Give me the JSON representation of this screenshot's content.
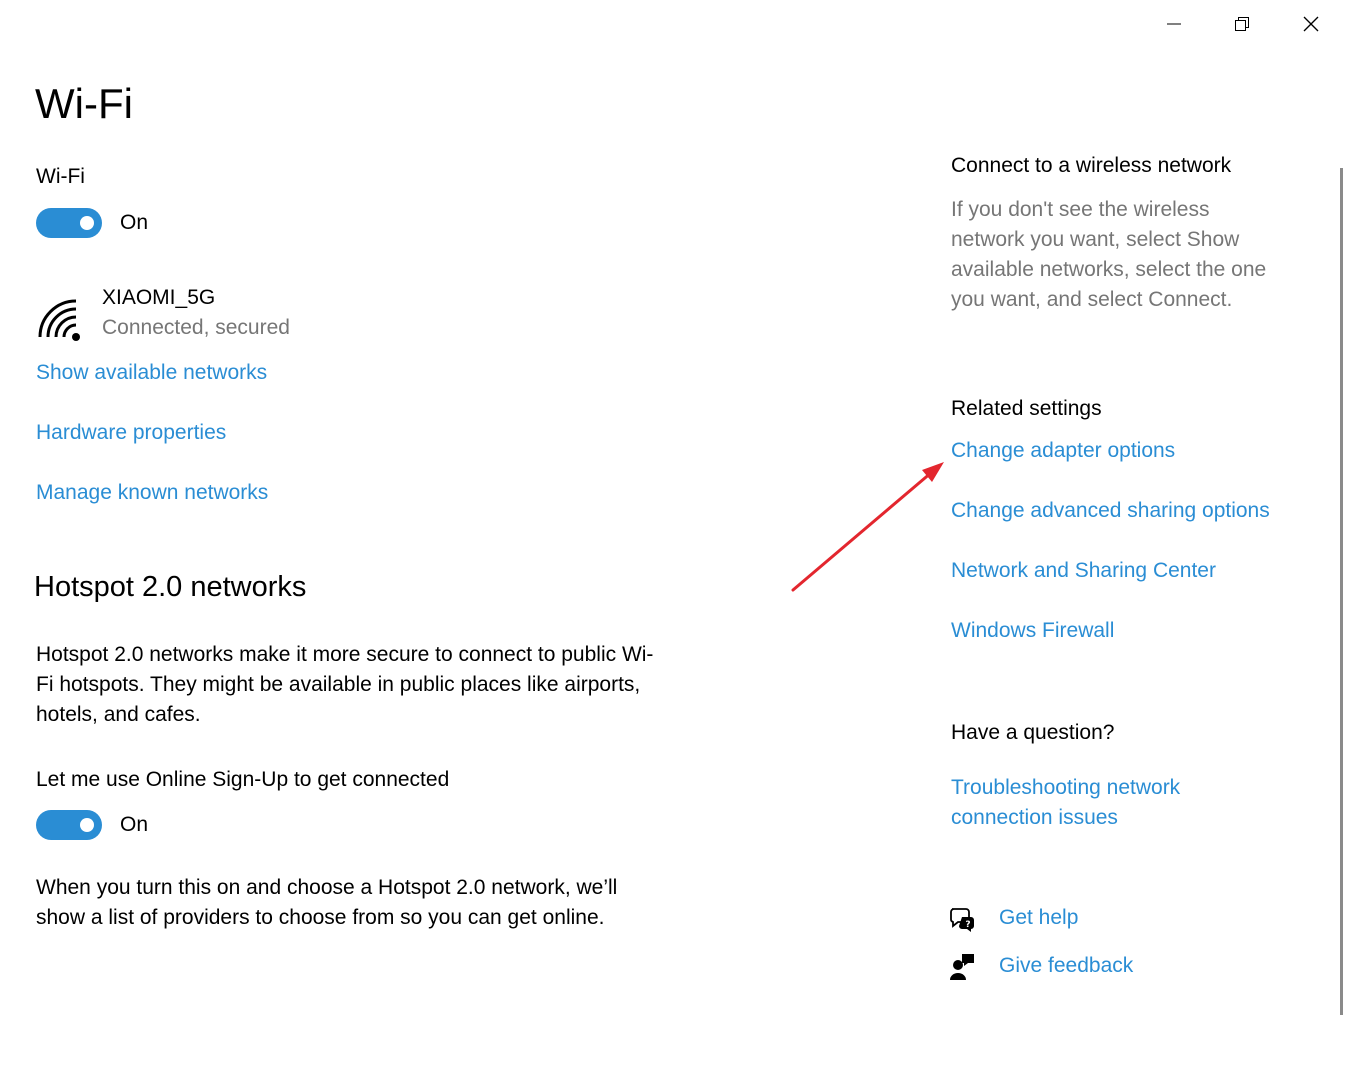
{
  "window": {
    "minimize_icon": "minimize-icon",
    "restore_icon": "restore-icon",
    "close_icon": "close-icon"
  },
  "page_title": "Wi-Fi",
  "wifi": {
    "label": "Wi-Fi",
    "toggle_state": "On",
    "network": {
      "name": "XIAOMI_5G",
      "status": "Connected, secured",
      "icon": "wifi-signal-icon"
    },
    "links": {
      "show_available": "Show available networks",
      "hardware_properties": "Hardware properties",
      "manage_known": "Manage known networks"
    }
  },
  "hotspot": {
    "heading": "Hotspot 2.0 networks",
    "description_line1": "Hotspot 2.0 networks make it more secure to connect to public Wi-",
    "description_line2": "Fi hotspots. They might be available in public places like airports,",
    "description_line3": "hotels, and cafes.",
    "online_signup_label": "Let me use Online Sign-Up to get connected",
    "online_signup_state": "On",
    "note_line1": "When you turn this on and choose a Hotspot 2.0 network, we’ll",
    "note_line2": "show a list of providers to choose from so you can get online."
  },
  "sidebar": {
    "connect_heading": "Connect to a wireless network",
    "connect_text_line1": "If you don't see the wireless",
    "connect_text_line2": "network you want, select Show",
    "connect_text_line3": "available networks, select the one",
    "connect_text_line4": "you want, and select Connect.",
    "related_heading": "Related settings",
    "related_links": [
      "Change adapter options",
      "Change advanced sharing options",
      "Network and Sharing Center",
      "Windows Firewall"
    ],
    "question_heading": "Have a question?",
    "troubleshoot_line1": "Troubleshooting network",
    "troubleshoot_line2": "connection issues",
    "get_help": "Get help",
    "give_feedback": "Give feedback"
  },
  "colors": {
    "accent": "#2a8dd4",
    "muted_text": "#767676",
    "annotation_arrow": "#e3262e"
  }
}
